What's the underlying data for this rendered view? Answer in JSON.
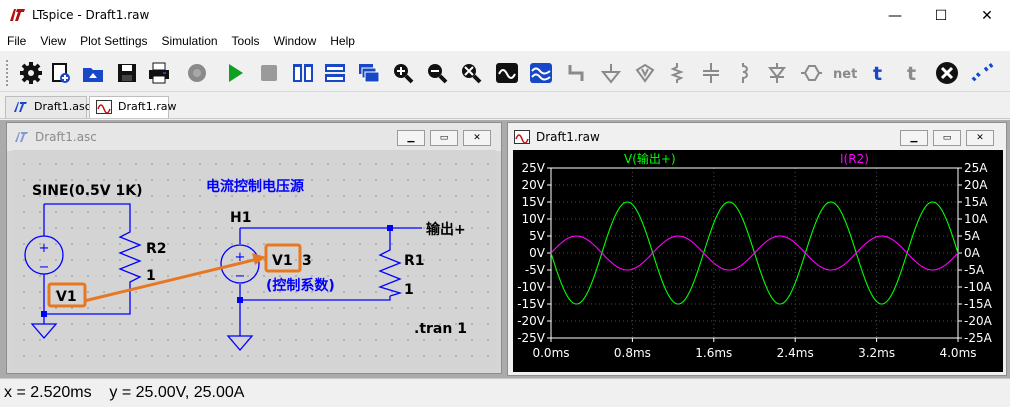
{
  "window": {
    "title": "LTspice - Draft1.raw",
    "minimize_glyph": "—",
    "maximize_glyph": "☐",
    "close_glyph": "✕"
  },
  "menu": {
    "file": "File",
    "view": "View",
    "plot_settings": "Plot Settings",
    "simulation": "Simulation",
    "tools": "Tools",
    "window": "Window",
    "help": "Help"
  },
  "toolbar_icons": [
    "gear-icon",
    "new-schematic-icon",
    "open-icon",
    "save-icon",
    "print-icon",
    "control-panel-icon",
    "run-icon",
    "halt-icon",
    "tile-vertical-icon",
    "tile-horizontal-icon",
    "cascade-icon",
    "zoom-in-icon",
    "zoom-out-icon",
    "zoom-fit-icon",
    "autorange-icon",
    "fft-icon",
    "wire-icon",
    "ground-icon",
    "label-net-icon",
    "resistor-icon",
    "capacitor-icon",
    "inductor-icon",
    "diode-icon",
    "component-icon",
    "netlist-icon",
    "text-icon",
    "spice-directive-icon",
    "delete-icon",
    "move-icon"
  ],
  "tabs": [
    {
      "label": "Draft1.asc"
    },
    {
      "label": "Draft1.raw"
    }
  ],
  "schematic": {
    "title": "Draft1.asc",
    "sine_label": "SINE(0.5V 1K)",
    "title_label": "电流控制电压源",
    "h1_label": "H1",
    "r2_label": "R2",
    "r2_value": "1",
    "r1_label": "R1",
    "r1_value": "1",
    "v1_label": "V1",
    "v1_ctrl_label": "V1",
    "gain_label": "3",
    "ctrl_coeff_label": "(控制系数)",
    "out_label": "输出+",
    "tran_label": ".tran 1"
  },
  "waveform": {
    "title": "Draft1.raw",
    "trace1_label": "V(输出+)",
    "trace2_label": "I(R2)",
    "colors": {
      "trace1": "#00ff00",
      "trace2": "#ff00ff",
      "axis": "#ffffff",
      "grid": "#5a5a5a",
      "schematic_wire": "#0000ff",
      "annotation": "#e87722"
    }
  },
  "chart_data": {
    "type": "line",
    "title": "",
    "xlabel": "",
    "ylabel": "",
    "y2label": "",
    "xlim": [
      0,
      4
    ],
    "ylim": [
      -25,
      25
    ],
    "y2lim": [
      -25,
      25
    ],
    "x_ticks": [
      "0.0ms",
      "0.8ms",
      "1.6ms",
      "2.4ms",
      "3.2ms",
      "4.0ms"
    ],
    "x_tick_values": [
      0,
      0.8,
      1.6,
      2.4,
      3.2,
      4.0
    ],
    "y_ticks": [
      "25V",
      "20V",
      "15V",
      "10V",
      "5V",
      "0V",
      "-5V",
      "-10V",
      "-15V",
      "-20V",
      "-25V"
    ],
    "y2_ticks": [
      "25A",
      "20A",
      "15A",
      "10A",
      "5A",
      "0A",
      "-5A",
      "-10A",
      "-15A",
      "-20A",
      "-25A"
    ],
    "y_tick_values": [
      25,
      20,
      15,
      10,
      5,
      0,
      -5,
      -10,
      -15,
      -20,
      -25
    ],
    "grid": true,
    "series": [
      {
        "name": "V(输出+)",
        "axis": "left",
        "color": "#00ff00",
        "amplitude": 15,
        "frequency_per_ms": 1,
        "phase_deg": 180
      },
      {
        "name": "I(R2)",
        "axis": "right",
        "color": "#ff00ff",
        "amplitude": 5,
        "frequency_per_ms": 1,
        "phase_deg": 0
      }
    ]
  },
  "status": {
    "text": "x = 2.520ms    y = 25.00V, 25.00A"
  }
}
